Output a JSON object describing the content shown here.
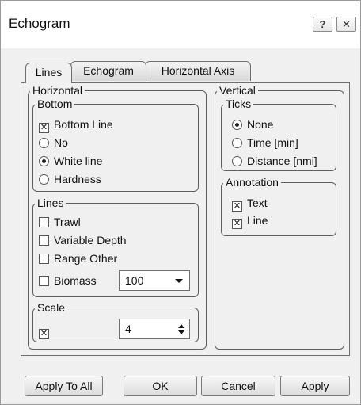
{
  "window": {
    "title": "Echogram",
    "help_label": "?",
    "close_label": "✕"
  },
  "tabs": [
    {
      "label": "Lines",
      "active": true
    },
    {
      "label": "Echogram",
      "active": false
    },
    {
      "label": "Horizontal Axis",
      "active": false
    }
  ],
  "horizontal": {
    "legend": "Horizontal",
    "bottom": {
      "legend": "Bottom",
      "bottom_line": {
        "label": "Bottom Line",
        "checked": true
      },
      "options": [
        {
          "label": "No",
          "selected": false
        },
        {
          "label": "White line",
          "selected": true
        },
        {
          "label": "Hardness",
          "selected": false
        }
      ]
    },
    "lines": {
      "legend": "Lines",
      "items": [
        {
          "label": "Trawl",
          "checked": false
        },
        {
          "label": "Variable Depth",
          "checked": false
        },
        {
          "label": "Range Other",
          "checked": false
        }
      ],
      "biomass": {
        "label": "Biomass",
        "checked": false,
        "value": "100"
      }
    },
    "scale": {
      "legend": "Scale",
      "checked": true,
      "value": "4"
    }
  },
  "vertical": {
    "legend": "Vertical",
    "ticks": {
      "legend": "Ticks",
      "options": [
        {
          "label": "None",
          "selected": true
        },
        {
          "label": "Time [min]",
          "selected": false
        },
        {
          "label": "Distance [nmi]",
          "selected": false
        }
      ]
    },
    "annotation": {
      "legend": "Annotation",
      "items": [
        {
          "label": "Text",
          "checked": true
        },
        {
          "label": "Line",
          "checked": true
        }
      ]
    }
  },
  "buttons": {
    "apply_to_all": "Apply To All",
    "ok": "OK",
    "cancel": "Cancel",
    "apply": "Apply"
  },
  "check_mark": "✕"
}
